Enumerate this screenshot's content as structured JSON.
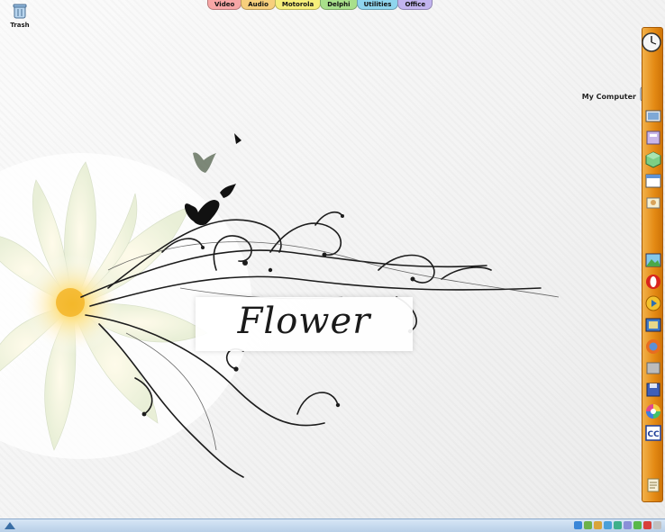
{
  "desktop": {
    "trash_label": "Trash",
    "my_computer_label": "My Computer",
    "wallpaper_text": "Flower"
  },
  "tabs": [
    {
      "label": "Video",
      "color": "#f7a6a6"
    },
    {
      "label": "Audio",
      "color": "#f7cf7c"
    },
    {
      "label": "Motorola",
      "color": "#f6ef7b"
    },
    {
      "label": "Delphi",
      "color": "#a8e08b"
    },
    {
      "label": "Utilities",
      "color": "#8fd5ee"
    },
    {
      "label": "Office",
      "color": "#c2b4ef"
    }
  ],
  "dock": {
    "icons": [
      "clock-icon",
      "display-icon",
      "film-icon",
      "archive-icon",
      "cube-icon",
      "window-icon",
      "hand-card-icon",
      "landscape-icon",
      "opera-icon",
      "media-player-icon",
      "picture-icon",
      "firefox-icon",
      "gray-box-icon",
      "floppy-icon",
      "color-wheel-icon",
      "cc-icon",
      "notepad-icon"
    ]
  },
  "colors": {
    "dock": "#e48a14",
    "taskbar": "#c6daf0"
  }
}
